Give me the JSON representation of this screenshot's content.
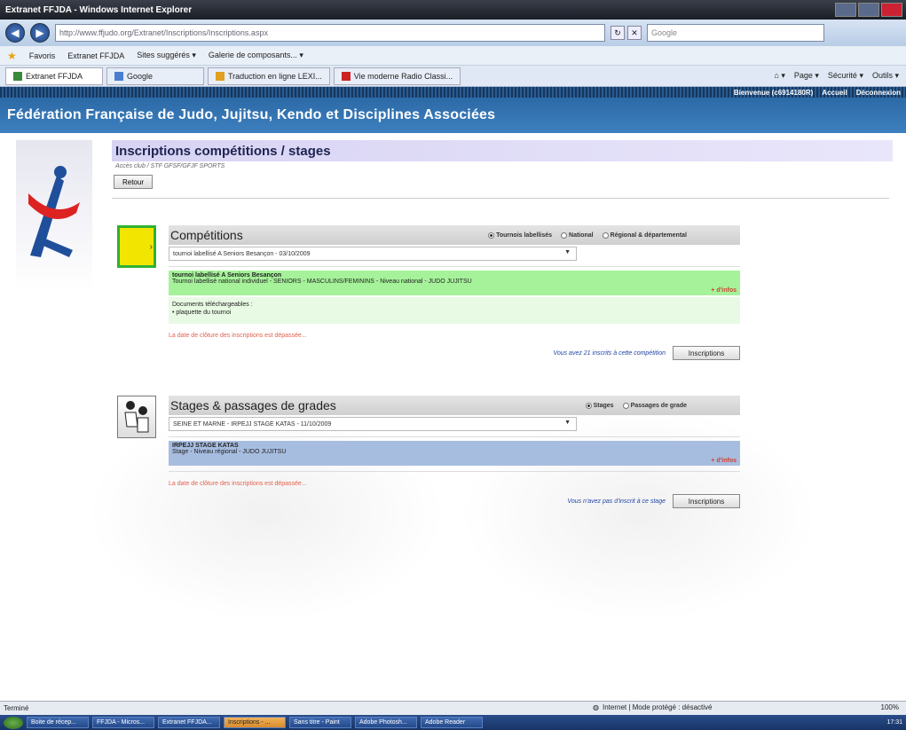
{
  "window": {
    "title": "Extranet FFJDA - Windows Internet Explorer"
  },
  "addressbar": {
    "url": "http://www.ffjudo.org/Extranet/Inscriptions/Inscriptions.aspx",
    "search_placeholder": "Google"
  },
  "favbar": {
    "favorites_label": "Favoris",
    "item1": "Extranet FFJDA",
    "item2": "Sites suggérés ▾",
    "item3": "Galerie de composants... ▾"
  },
  "tabs": [
    {
      "label": "Extranet FFJDA"
    },
    {
      "label": "Google"
    },
    {
      "label": "Traduction en ligne LEXI..."
    },
    {
      "label": "Vie moderne Radio Classi..."
    }
  ],
  "cmdbar": {
    "page": "Page ▾",
    "security": "Sécurité ▾",
    "tools": "Outils ▾"
  },
  "site": {
    "top_links": {
      "welcome": "Bienvenue (c6914180R)",
      "home": "Accueil",
      "logout": "Déconnexion"
    },
    "banner": "Fédération Française de Judo, Jujitsu, Kendo et Disciplines Associées"
  },
  "main": {
    "heading": "Inscriptions compétitions / stages",
    "breadcrumb": "Accès club / STF GFSF/GFJF SPORTS",
    "back_label": "Retour"
  },
  "competitions": {
    "title": "Compétitions",
    "radios": [
      {
        "label": "Tournois labellisés",
        "checked": true
      },
      {
        "label": "National",
        "checked": false
      },
      {
        "label": "Régional & départemental",
        "checked": false
      }
    ],
    "selected": "tournoi labellisé A Seniors Besançon - 03/10/2009",
    "info_title": "tournoi labellisé A Seniors Besançon",
    "info_detail": "Tournoi labellisé national individuel - SENIORS - MASCULINS/FEMININS - Niveau national - JUDO JUJITSU",
    "more": "+ d'infos",
    "docs_title": "Documents téléchargeables :",
    "docs_item": "• plaquette du tournoi",
    "closed_msg": "La date de clôture des inscriptions est dépassée...",
    "registered_msg": "Vous avez 21 inscrits à cette compétition",
    "register_btn": "Inscriptions"
  },
  "stages": {
    "title": "Stages & passages de grades",
    "radios": [
      {
        "label": "Stages",
        "checked": true
      },
      {
        "label": "Passages de grade",
        "checked": false
      }
    ],
    "selected": "SEINE ET MARNE - IRPEJJ STAGE KATAS - 11/10/2009",
    "info_title": "IRPEJJ STAGE KATAS",
    "info_detail": "Stage - Niveau régional - JUDO JUJITSU",
    "more": "+ d'infos",
    "closed_msg": "La date de clôture des inscriptions est dépassée...",
    "registered_msg": "Vous n'avez pas d'inscrit à ce stage",
    "register_btn": "Inscriptions"
  },
  "statusbar": {
    "left": "Terminé",
    "zone": "Internet | Mode protégé : désactivé",
    "zoom": "100%"
  },
  "taskbar": {
    "items": [
      "Boite de récep...",
      "FFJDA - Micros...",
      "Extranet FFJDA...",
      "Inscriptions - ...",
      "Sans titre - Paint",
      "Adobe Photosh...",
      "Adobe Reader"
    ],
    "clock": "17:31"
  },
  "colors": {
    "banner": "#3d7fbf",
    "comp_info": "#a6f29a",
    "stage_info": "#a7bde0",
    "warn": "#e0604e"
  }
}
